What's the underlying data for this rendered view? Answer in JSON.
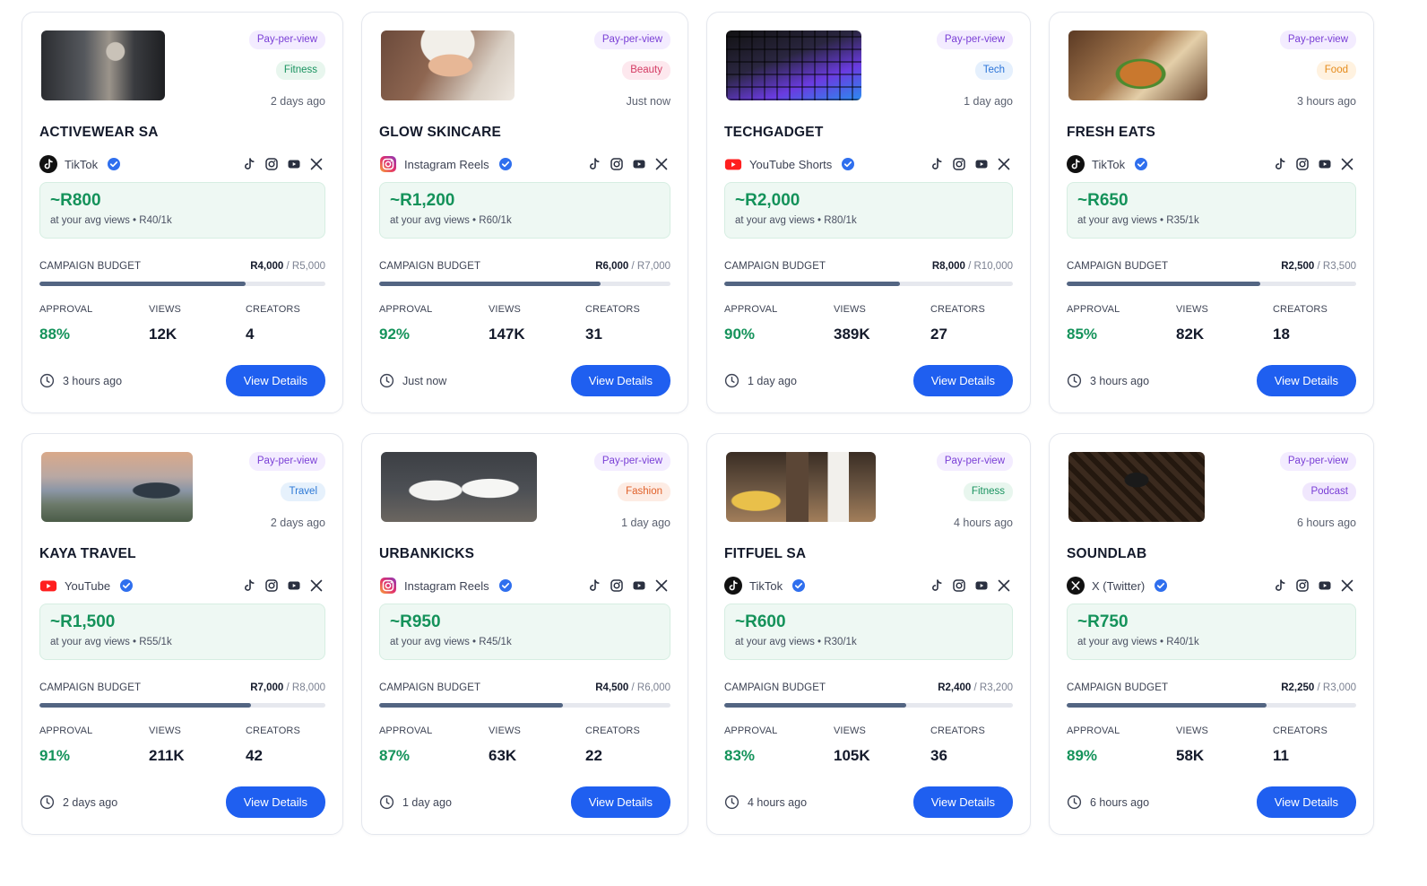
{
  "labels": {
    "ppv": "Pay-per-view",
    "campaign_budget": "CAMPAIGN BUDGET",
    "approval": "APPROVAL",
    "views": "VIEWS",
    "creators": "CREATORS",
    "view_details": "View Details",
    "earn_prefix": "at your avg views • "
  },
  "colors": {
    "accent": "#1f5ff0",
    "earn_green": "#14925a",
    "bar": "#536582"
  },
  "campaigns": [
    {
      "brand": "ACTIVEWEAR SA",
      "category": "Fitness",
      "cat_class": "c-green",
      "posted_ago": "2 days ago",
      "platform": "TikTok",
      "platform_icon": "tiktok-icon",
      "earn": "~R800",
      "rate": "R40/1k",
      "budget_used": "R4,000",
      "budget_total": " / R5,000",
      "progress": 0.72,
      "approval": "88%",
      "views": "12K",
      "creators": "4",
      "updated_ago": "3 hours ago",
      "image_desc": "gym"
    },
    {
      "brand": "GLOW SKINCARE",
      "category": "Beauty",
      "cat_class": "c-pink",
      "posted_ago": "Just now",
      "platform": "Instagram Reels",
      "platform_icon": "instagram-icon",
      "earn": "~R1,200",
      "rate": "R60/1k",
      "budget_used": "R6,000",
      "budget_total": " / R7,000",
      "progress": 0.76,
      "approval": "92%",
      "views": "147K",
      "creators": "31",
      "updated_ago": "Just now",
      "image_desc": "skin"
    },
    {
      "brand": "TECHGADGET",
      "category": "Tech",
      "cat_class": "c-blue",
      "posted_ago": "1 day ago",
      "platform": "YouTube Shorts",
      "platform_icon": "youtube-icon",
      "earn": "~R2,000",
      "rate": "R80/1k",
      "budget_used": "R8,000",
      "budget_total": " / R10,000",
      "progress": 0.61,
      "approval": "90%",
      "views": "389K",
      "creators": "27",
      "updated_ago": "1 day ago",
      "image_desc": "keyboard"
    },
    {
      "brand": "FRESH EATS",
      "category": "Food",
      "cat_class": "c-orange",
      "posted_ago": "3 hours ago",
      "platform": "TikTok",
      "platform_icon": "tiktok-icon",
      "earn": "~R650",
      "rate": "R35/1k",
      "budget_used": "R2,500",
      "budget_total": " / R3,500",
      "progress": 0.67,
      "approval": "85%",
      "views": "82K",
      "creators": "18",
      "updated_ago": "3 hours ago",
      "image_desc": "burger"
    },
    {
      "brand": "KAYA TRAVEL",
      "category": "Travel",
      "cat_class": "c-blue2",
      "posted_ago": "2 days ago",
      "platform": "YouTube",
      "platform_icon": "youtube-icon",
      "earn": "~R1,500",
      "rate": "R55/1k",
      "budget_used": "R7,000",
      "budget_total": " / R8,000",
      "progress": 0.74,
      "approval": "91%",
      "views": "211K",
      "creators": "42",
      "updated_ago": "2 days ago",
      "image_desc": "coast"
    },
    {
      "brand": "URBANKICKS",
      "category": "Fashion",
      "cat_class": "c-orange2",
      "posted_ago": "1 day ago",
      "platform": "Instagram Reels",
      "platform_icon": "instagram-icon",
      "earn": "~R950",
      "rate": "R45/1k",
      "budget_used": "R4,500",
      "budget_total": " / R6,000",
      "progress": 0.63,
      "approval": "87%",
      "views": "63K",
      "creators": "22",
      "updated_ago": "1 day ago",
      "image_desc": "sneakers"
    },
    {
      "brand": "FITFUEL SA",
      "category": "Fitness",
      "cat_class": "c-green",
      "posted_ago": "4 hours ago",
      "platform": "TikTok",
      "platform_icon": "tiktok-icon",
      "earn": "~R600",
      "rate": "R30/1k",
      "budget_used": "R2,400",
      "budget_total": " / R3,200",
      "progress": 0.63,
      "approval": "83%",
      "views": "105K",
      "creators": "36",
      "updated_ago": "4 hours ago",
      "image_desc": "shaker"
    },
    {
      "brand": "SOUNDLAB",
      "category": "Podcast",
      "cat_class": "c-purple",
      "posted_ago": "6 hours ago",
      "platform": "X (Twitter)",
      "platform_icon": "x-icon",
      "earn": "~R750",
      "rate": "R40/1k",
      "budget_used": "R2,250",
      "budget_total": " / R3,000",
      "progress": 0.69,
      "approval": "89%",
      "views": "58K",
      "creators": "11",
      "updated_ago": "6 hours ago",
      "image_desc": "mic"
    }
  ]
}
